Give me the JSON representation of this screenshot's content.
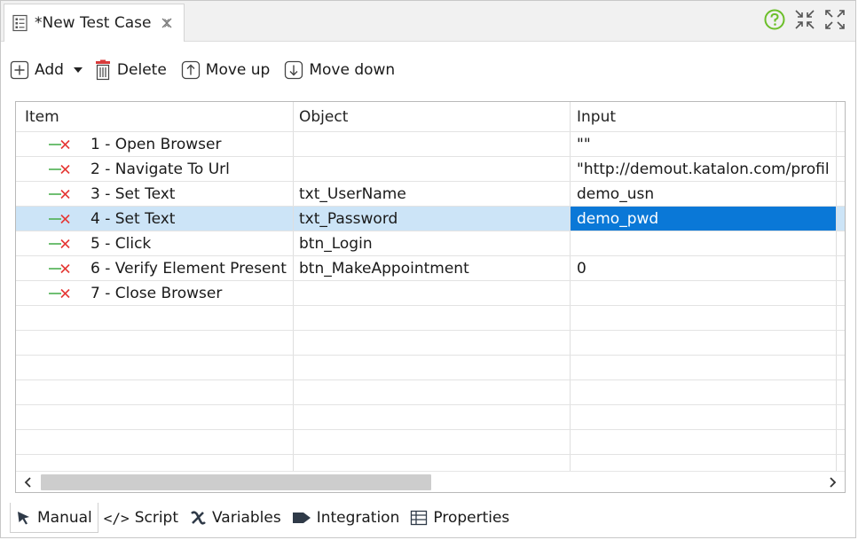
{
  "editor_tab": {
    "title": "*New Test Case"
  },
  "toolbar": {
    "add_label": "Add",
    "delete_label": "Delete",
    "move_up_label": "Move up",
    "move_down_label": "Move down"
  },
  "table": {
    "columns": [
      "Item",
      "Object",
      "Input"
    ],
    "rows": [
      {
        "item": "1 - Open Browser",
        "object": "",
        "input": "\"\""
      },
      {
        "item": "2 - Navigate To Url",
        "object": "",
        "input": "\"http://demout.katalon.com/profil"
      },
      {
        "item": "3 - Set Text",
        "object": "txt_UserName",
        "input": "demo_usn"
      },
      {
        "item": "4 - Set Text",
        "object": "txt_Password",
        "input": "demo_pwd"
      },
      {
        "item": "5 - Click",
        "object": "btn_Login",
        "input": ""
      },
      {
        "item": "6 - Verify Element Present",
        "object": "btn_MakeAppointment",
        "input": "0"
      },
      {
        "item": "7 - Close Browser",
        "object": "",
        "input": ""
      }
    ],
    "selected_row": 4
  },
  "bottom_tabs": {
    "manual": "Manual",
    "script": "Script",
    "variables": "Variables",
    "integration": "Integration",
    "properties": "Properties"
  },
  "colors": {
    "selection_row": "#cce4f7",
    "selection_cell": "#0a78d7",
    "step_icon_green": "#4caf50",
    "step_icon_red": "#e53935",
    "help_icon": "#6cbf2a",
    "delete_icon": "#d83b3b"
  }
}
